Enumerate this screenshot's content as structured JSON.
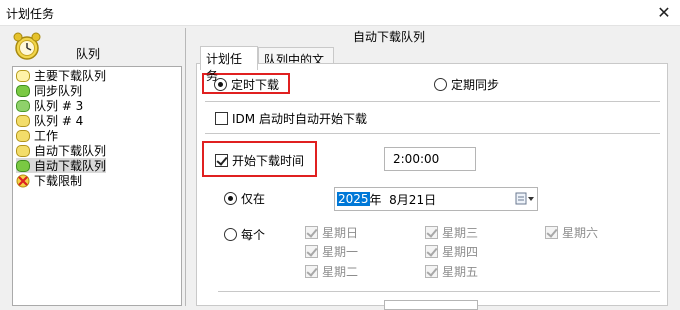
{
  "window": {
    "title": "计划任务"
  },
  "left": {
    "header": "队列",
    "queues": [
      {
        "label": "主要下载队列",
        "icon": "main-queue-icon"
      },
      {
        "label": "同步队列",
        "icon": "sync-queue-icon"
      },
      {
        "label": "队列 # 3",
        "icon": "queue-folder-icon"
      },
      {
        "label": "队列 # 4",
        "icon": "queue-folder-icon"
      },
      {
        "label": "工作",
        "icon": "queue-folder-icon"
      },
      {
        "label": "自动下载队列",
        "icon": "queue-folder-icon"
      },
      {
        "label": "自动下载队列",
        "icon": "queue-green-icon"
      },
      {
        "label": "下载限制",
        "icon": "download-limit-icon"
      }
    ],
    "selected_index": 6
  },
  "right": {
    "header": "自动下载队列",
    "tabs": [
      {
        "label": "计划任务"
      },
      {
        "label": "队列中的文件"
      }
    ],
    "mode": {
      "scheduled": "定时下载",
      "periodic": "定期同步"
    },
    "idm_start": "IDM 启动时自动开始下载",
    "start_time": {
      "label": "开始下载时间",
      "value": "2:00:00"
    },
    "once": {
      "label": "仅在",
      "date_year": "2025",
      "date_rest": "年  8月21日"
    },
    "daily": {
      "label": "每个",
      "days": [
        "星期日",
        "星期三",
        "星期六",
        "星期一",
        "星期四",
        "星期二",
        "星期五"
      ]
    }
  }
}
